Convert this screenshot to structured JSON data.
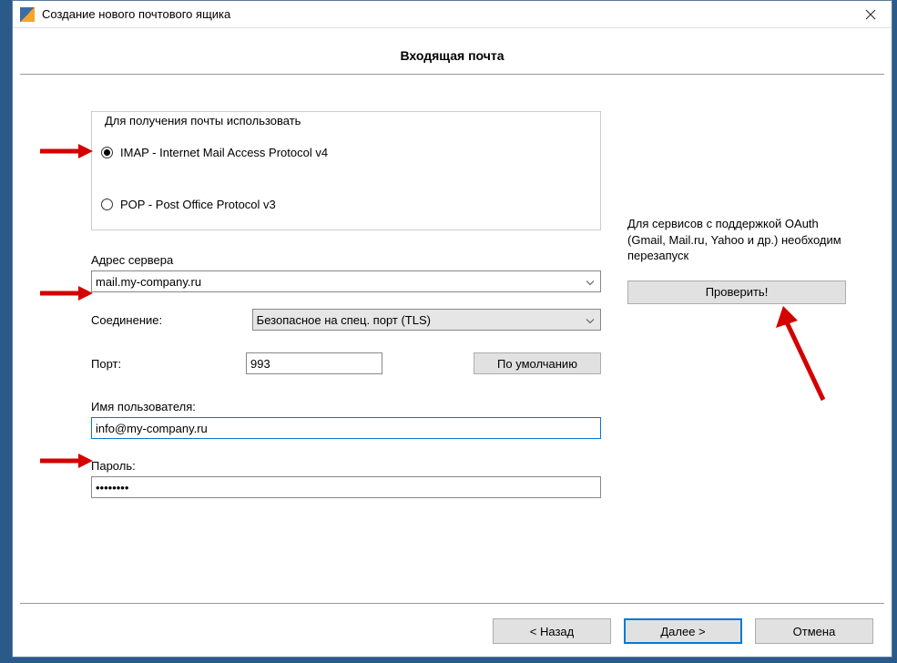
{
  "window": {
    "title": "Создание нового почтового ящика"
  },
  "header": {
    "title": "Входящая почта"
  },
  "protocol": {
    "group_label": "Для получения почты использовать",
    "imap": {
      "label": "IMAP - Internet Mail Access Protocol v4",
      "selected": true
    },
    "pop": {
      "label": "POP  -  Post Office Protocol v3",
      "selected": false
    }
  },
  "server": {
    "label": "Адрес сервера",
    "value": "mail.my-company.ru"
  },
  "connection": {
    "label": "Соединение:",
    "value": "Безопасное на спец. порт (TLS)"
  },
  "port": {
    "label": "Порт:",
    "value": "993",
    "default_btn": "По умолчанию"
  },
  "username": {
    "label": "Имя пользователя:",
    "value": "info@my-company.ru"
  },
  "password": {
    "label": "Пароль:",
    "value": "••••••••"
  },
  "oauth": {
    "hint": "Для сервисов с поддержкой OAuth (Gmail, Mail.ru, Yahoo и др.) необходим перезапуск",
    "check_btn": "Проверить!"
  },
  "footer": {
    "back": "<  Назад",
    "next": "Далее   >",
    "cancel": "Отмена"
  }
}
